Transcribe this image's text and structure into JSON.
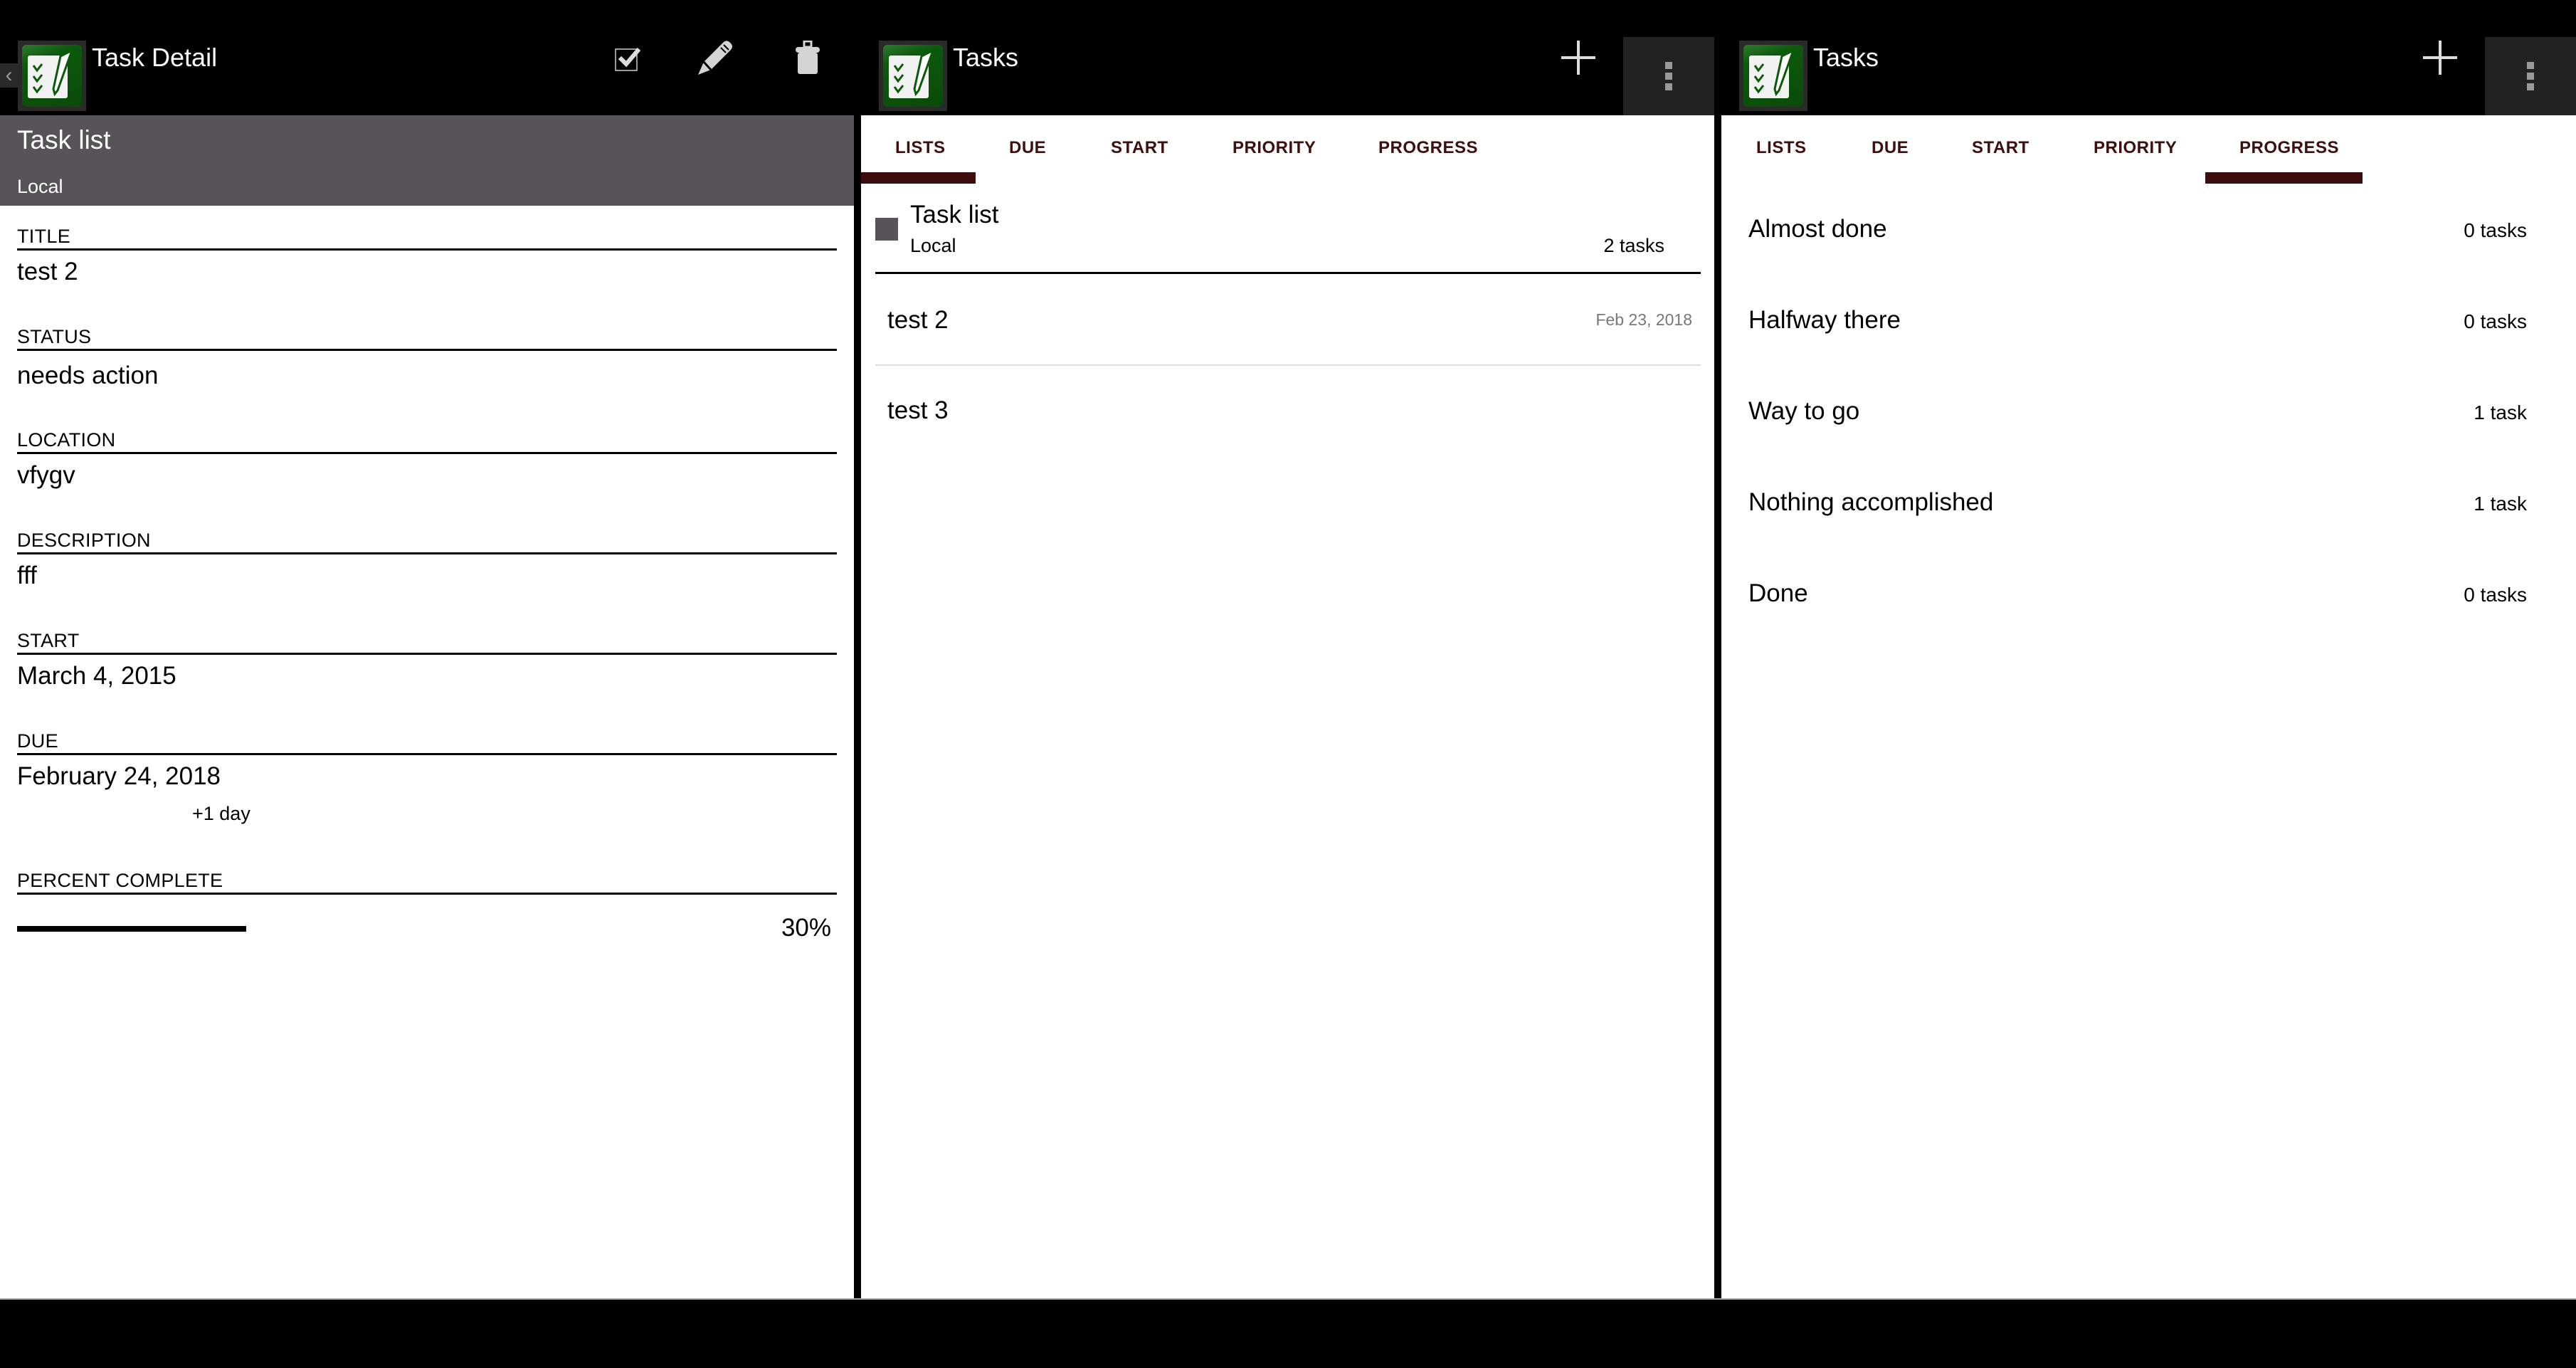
{
  "colors": {
    "header_band": "#575457",
    "tab_text": "#3d0f0f",
    "tab_indicator": "#3d0c0c",
    "app_icon_green": "#0a4a0a"
  },
  "detail": {
    "actionbar": {
      "title": "Task Detail",
      "icons": [
        "back-chevron-icon",
        "app-icon",
        "complete-checkbox-icon",
        "edit-pencil-icon",
        "delete-trash-icon"
      ]
    },
    "list_header": {
      "name": "Task list",
      "account": "Local"
    },
    "fields": {
      "title": {
        "label": "TITLE",
        "value": "test 2"
      },
      "status": {
        "label": "STATUS",
        "value": "needs action"
      },
      "location": {
        "label": "LOCATION",
        "value": "vfygv"
      },
      "description": {
        "label": "DESCRIPTION",
        "value": "fff"
      },
      "start": {
        "label": "START",
        "value": "March 4, 2015"
      },
      "due": {
        "label": "DUE",
        "value": "February 24, 2018",
        "relative": "+1 day"
      },
      "percent": {
        "label": "PERCENT COMPLETE",
        "value": 30,
        "display": "30%"
      }
    }
  },
  "lists_view": {
    "actionbar": {
      "title": "Tasks",
      "icons": [
        "app-icon",
        "add-plus-icon",
        "overflow-menu-icon"
      ]
    },
    "tabs": [
      {
        "label": "LISTS",
        "active": true
      },
      {
        "label": "DUE",
        "active": false
      },
      {
        "label": "START",
        "active": false
      },
      {
        "label": "PRIORITY",
        "active": false
      },
      {
        "label": "PROGRESS",
        "active": false
      }
    ],
    "group": {
      "name": "Task list",
      "account": "Local",
      "count": "2 tasks",
      "color": "#575457"
    },
    "tasks": [
      {
        "title": "test 2",
        "date": "Feb 23, 2018"
      },
      {
        "title": "test 3",
        "date": ""
      }
    ]
  },
  "progress_view": {
    "actionbar": {
      "title": "Tasks",
      "icons": [
        "app-icon",
        "add-plus-icon",
        "overflow-menu-icon"
      ]
    },
    "tabs": [
      {
        "label": "LISTS",
        "active": false
      },
      {
        "label": "DUE",
        "active": false
      },
      {
        "label": "START",
        "active": false
      },
      {
        "label": "PRIORITY",
        "active": false
      },
      {
        "label": "PROGRESS",
        "active": true
      }
    ],
    "groups": [
      {
        "label": "Almost done",
        "count": "0 tasks"
      },
      {
        "label": "Halfway there",
        "count": "0 tasks"
      },
      {
        "label": "Way to go",
        "count": "1 task"
      },
      {
        "label": "Nothing accomplished",
        "count": "1 task"
      },
      {
        "label": "Done",
        "count": "0 tasks"
      }
    ]
  }
}
